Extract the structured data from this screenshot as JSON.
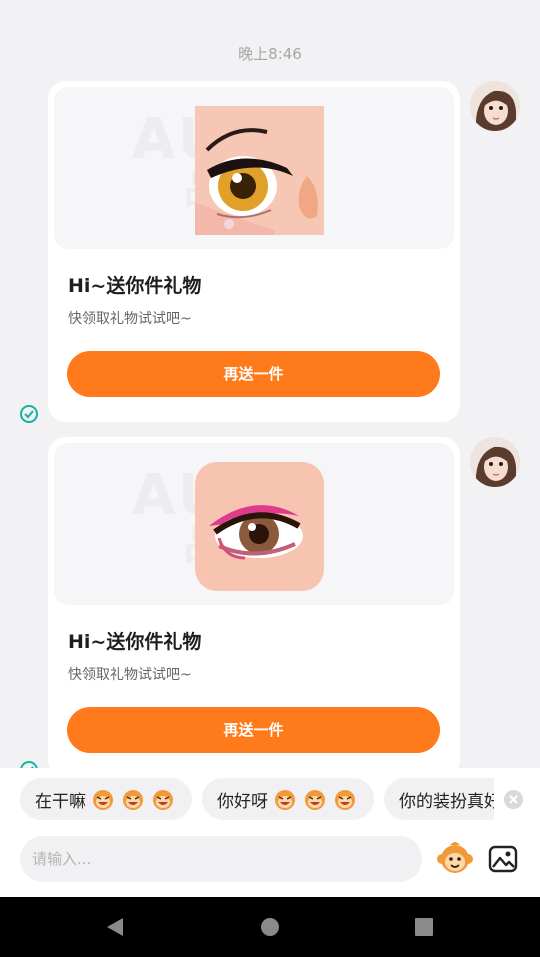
{
  "chat": {
    "timestamp": "晚上8:46",
    "messages": [
      {
        "card_title": "Hi~送你件礼物",
        "card_subtitle": "快领取礼物试试吧~",
        "button_label": "再送一件",
        "watermark_line1": "AURA",
        "watermark_line2": "品牌"
      },
      {
        "card_title": "Hi~送你件礼物",
        "card_subtitle": "快领取礼物试试吧~",
        "button_label": "再送一件",
        "watermark_line1": "AURA",
        "watermark_line2": "品牌"
      }
    ]
  },
  "quick_replies": [
    {
      "label": "在干嘛",
      "emoji_count": 3
    },
    {
      "label": "你好呀",
      "emoji_count": 3
    },
    {
      "label": "你的装扮真好",
      "emoji_count": 0
    }
  ],
  "input": {
    "placeholder": "请输入..."
  },
  "colors": {
    "accent": "#ff7a1a",
    "check": "#13b5a0",
    "background": "#f2f2f4"
  },
  "icons": {
    "emoji_button": "monkey-face-icon",
    "image_button": "image-icon",
    "nav_back": "back-triangle-icon",
    "nav_home": "home-circle-icon",
    "nav_recents": "recents-square-icon"
  }
}
